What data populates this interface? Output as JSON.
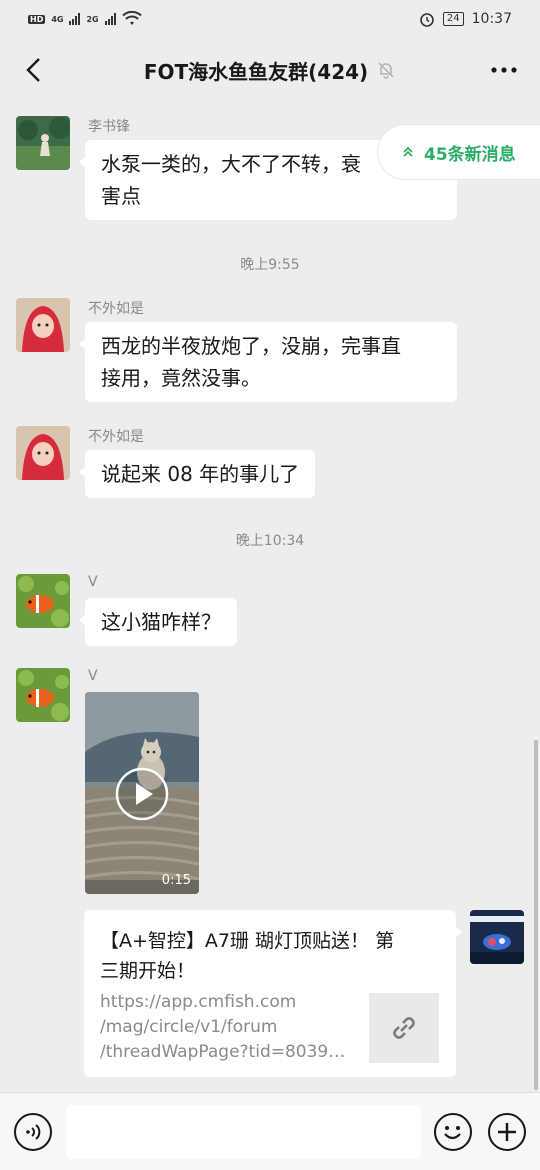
{
  "status_bar": {
    "network": "HD",
    "sig1": "4G",
    "sig2": "2G",
    "battery": "24",
    "time": "10:37"
  },
  "header": {
    "title": "FOT海水鱼鱼友群(424)",
    "back_icon": "chevron-left-icon",
    "mute_icon": "bell-off-icon",
    "more_icon": "more-horizontal-icon"
  },
  "new_messages": {
    "label": "45条新消息",
    "icon": "double-chevron-up-icon"
  },
  "messages": [
    {
      "nick": "李书锋",
      "text": "水泵一类的，大不了不转，老 ... 害点",
      "line1": "水泵一类的，大不了不转，衰",
      "line2": "害点"
    },
    {
      "time": "晚上9:55"
    },
    {
      "nick": "不外如是",
      "line1": "西龙的半夜放炮了，没崩，完事直",
      "line2": "接用，竟然没事。"
    },
    {
      "nick": "不外如是",
      "line1": "说起来 08 年的事儿了"
    },
    {
      "time": "晚上10:34"
    },
    {
      "nick": "V",
      "line1": "这小猫咋样？"
    },
    {
      "nick": "V",
      "video_duration": "0:15"
    }
  ],
  "link_card": {
    "title_line1": "【A+智控】A7珊 瑚灯顶贴送！ 第",
    "title_line2": "三期开始！",
    "url_line1": "https://app.cmfish.com",
    "url_line2": "/mag/circle/v1/forum",
    "url_line3": "/threadWapPage?tid=80391...",
    "thumb_icon": "link-icon"
  },
  "colors": {
    "accent": "#2aae67",
    "background": "#ededed"
  }
}
